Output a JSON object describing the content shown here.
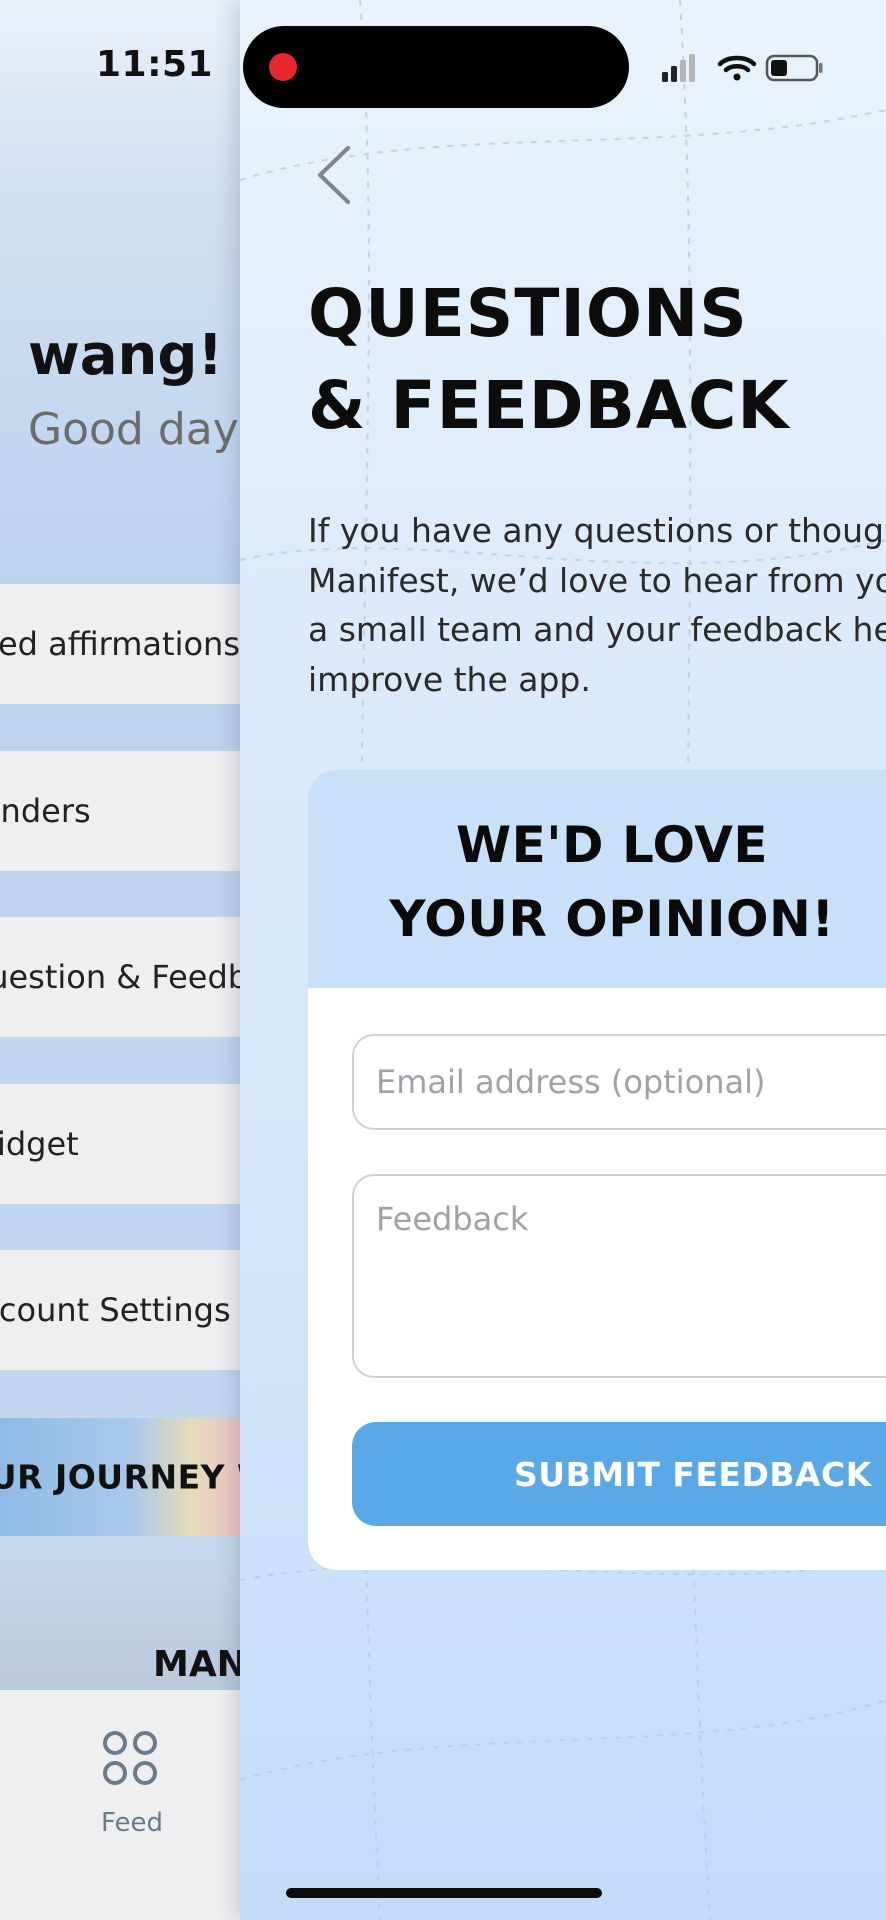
{
  "status_bar": {
    "time": "11:51"
  },
  "menu_screen": {
    "greeting_name": "wang!",
    "greeting_sub": "Good day!",
    "items": [
      {
        "label": "Saved affirmations"
      },
      {
        "label": "Reminders"
      },
      {
        "label": "Question & Feedback"
      },
      {
        "label": "Widget"
      },
      {
        "label": "Account Settings"
      }
    ],
    "journey_banner": "YOUR JOURNEY W",
    "manifest_label": "MANIFEST",
    "tab_feed": "Feed"
  },
  "feedback_screen": {
    "title_line1": "QUESTIONS",
    "title_line2": "& FEEDBACK",
    "description_lines": [
      "If you have any questions or thoughts about",
      "Manifest, we’d love to hear from you. We are",
      "a small team and your feedback helps us",
      "improve the app."
    ],
    "card_title_line1": "WE'D LOVE",
    "card_title_line2": "YOUR OPINION!",
    "email_placeholder": "Email address (optional)",
    "feedback_placeholder": "Feedback",
    "submit_label": "SUBMIT FEEDBACK"
  },
  "icons": {
    "back": "chevron-left-icon",
    "feed": "grid-icon",
    "signal": "cellular-signal-icon",
    "wifi": "wifi-icon",
    "battery": "battery-icon",
    "recording": "recording-dot-icon"
  },
  "colors": {
    "accent": "#5aa9e6",
    "card_header": "#c9e0f9",
    "recording": "#e8262b"
  }
}
